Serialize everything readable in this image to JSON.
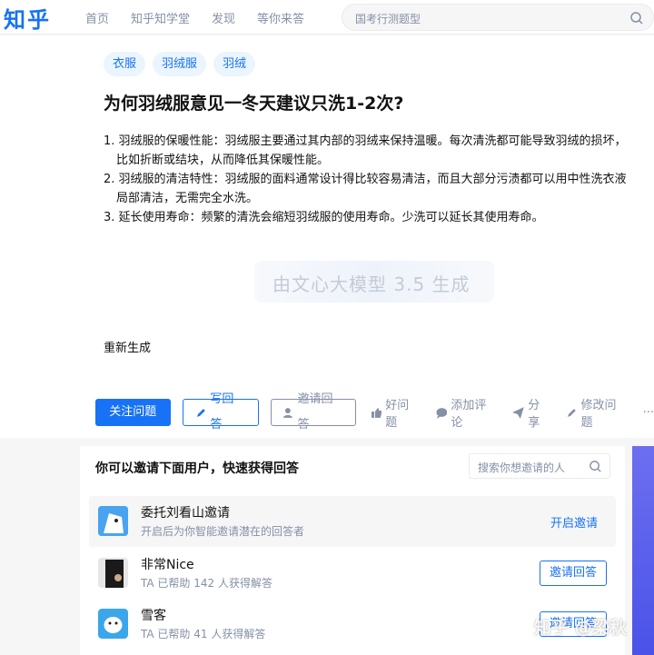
{
  "header": {
    "logo": "知乎",
    "nav": [
      "首页",
      "知乎知学堂",
      "发现",
      "等你来答"
    ],
    "search_placeholder": "国考行测题型"
  },
  "question": {
    "tags": [
      "衣服",
      "羽绒服",
      "羽绒"
    ],
    "title": "为何羽绒服意见一冬天建议只洗1-2次?",
    "answer_items": [
      "1. 羽绒服的保暖性能：羽绒服主要通过其内部的羽绒来保持温暖。每次清洗都可能导致羽绒的损坏，比如折断或结块，从而降低其保暖性能。",
      "2. 羽绒服的清洁特性：羽绒服的面料通常设计得比较容易清洁，而且大部分污渍都可以用中性洗衣液局部清洁，无需完全水洗。",
      "3. 延长使用寿命：频繁的清洗会缩短羽绒服的使用寿命。少洗可以延长其使用寿命。"
    ],
    "generated_by": "由文心大模型 3.5 生成",
    "regenerate": "重新生成"
  },
  "actions": {
    "follow": "关注问题",
    "write": "写回答",
    "invite": "邀请回答",
    "good": "好问题",
    "comment": "添加评论",
    "share": "分享",
    "edit": "修改问题",
    "more": "···"
  },
  "invite": {
    "title": "你可以邀请下面用户，快速获得回答",
    "search_placeholder": "搜索你想邀请的人",
    "users": [
      {
        "name": "委托刘看山邀请",
        "desc": "开启后为你智能邀请潜在的回答者",
        "action": "开启邀请"
      },
      {
        "name": "非常Nice",
        "desc": "TA 已帮助 142 人获得解答",
        "action": "邀请回答"
      },
      {
        "name": "雪客",
        "desc": "TA 已帮助 41 人获得解答",
        "action": "邀请回答"
      }
    ]
  },
  "watermark": "知乎 @梁秋"
}
